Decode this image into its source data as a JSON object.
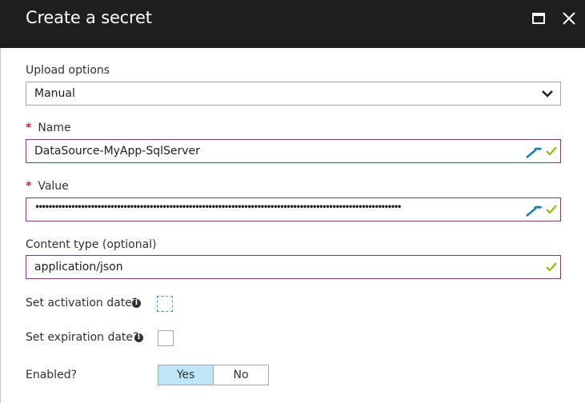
{
  "header": {
    "title": "Create a secret"
  },
  "upload": {
    "label": "Upload options",
    "value": "Manual"
  },
  "name": {
    "label": "Name",
    "required_mark": "*",
    "value": "DataSource-MyApp-SqlServer"
  },
  "value_field": {
    "label": "Value",
    "required_mark": "*",
    "masked": "••••••••••••••••••••••••••••••••••••••••••••••••••••••••••••••••••••••••••••••••••••••••••••••••••••••••••••••••"
  },
  "content_type": {
    "label": "Content type (optional)",
    "value": "application/json"
  },
  "activation": {
    "label": "Set activation date?",
    "info": "i",
    "checked": false
  },
  "expiration": {
    "label": "Set expiration date?",
    "info": "i",
    "checked": false
  },
  "enabled": {
    "label": "Enabled?",
    "yes": "Yes",
    "no": "No",
    "selected": "Yes"
  },
  "colors": {
    "header_bg": "#1e1e1e",
    "valid_border": "#7a3b7a",
    "check": "#7fba00",
    "toggle_selected": "#bfe6f8",
    "required": "#e81123"
  },
  "icons": [
    "maximize-icon",
    "close-icon",
    "chevron-down-icon",
    "validation-check-icon",
    "password-wand-icon",
    "info-icon"
  ]
}
